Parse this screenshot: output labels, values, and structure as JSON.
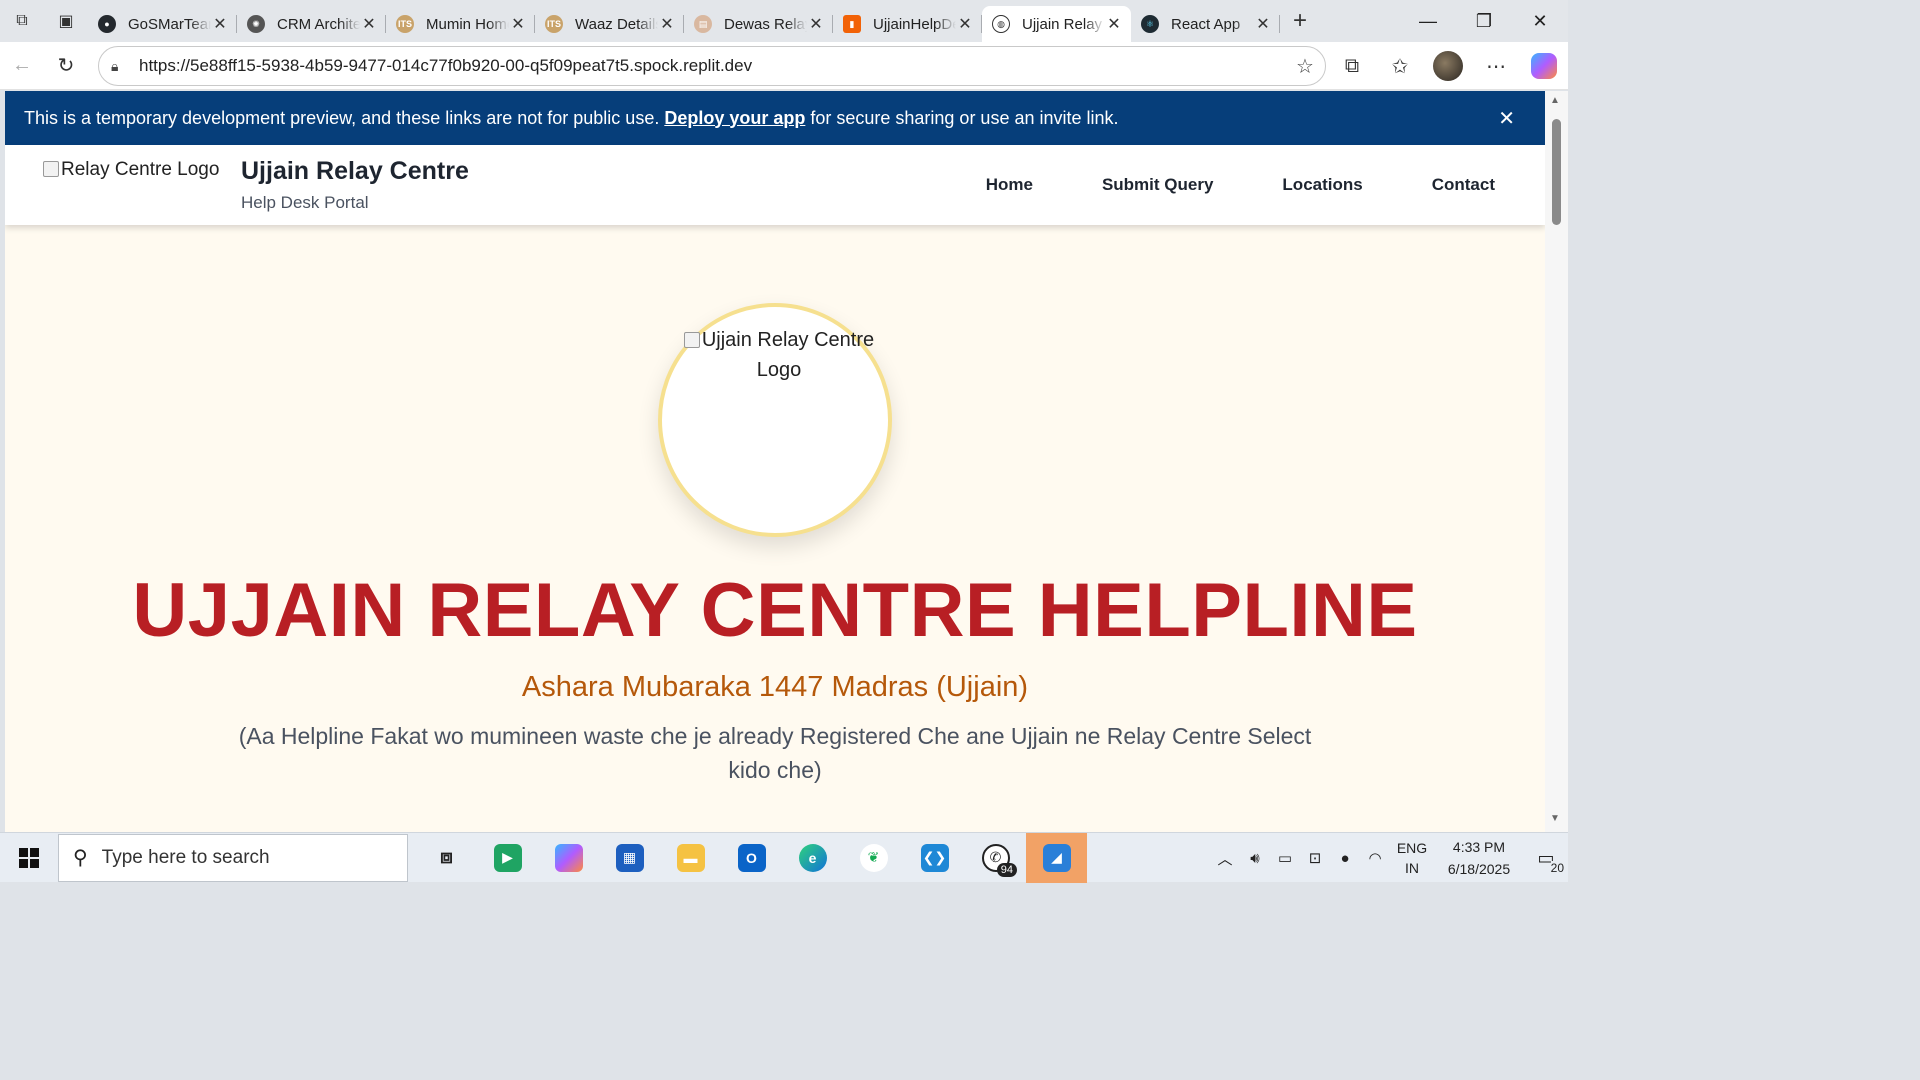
{
  "browser": {
    "tabs": [
      {
        "title": "GoSMarTeam",
        "icon": "github-icon",
        "color": "#24292e"
      },
      {
        "title": "CRM Architecture",
        "icon": "openai-icon",
        "color": "#555555"
      },
      {
        "title": "Mumin Home",
        "icon": "its-icon",
        "color": "#c9a36a"
      },
      {
        "title": "Waaz Details",
        "icon": "its-icon",
        "color": "#c9a36a"
      },
      {
        "title": "Dewas Relay",
        "icon": "page-icon",
        "color": "#d9b8a0"
      },
      {
        "title": "UjjainHelpDesk",
        "icon": "replit-icon",
        "color": "#f26207"
      },
      {
        "title": "Ujjain Relay Centre",
        "icon": "globe-icon",
        "color": "#444444",
        "active": true
      },
      {
        "title": "React App",
        "icon": "react-icon",
        "color": "#1e2b33"
      }
    ],
    "url": "https://5e88ff15-5938-4b59-9477-014c77f0b920-00-q5f09peat7t5.spock.replit.dev"
  },
  "banner": {
    "text_before": "This is a temporary development preview, and these links are not for public use.",
    "link": "Deploy your app",
    "text_after": "for secure sharing or use an invite link.",
    "close": "✕"
  },
  "header": {
    "logo_alt": "Relay Centre Logo",
    "title": "Ujjain Relay Centre",
    "subtitle": "Help Desk Portal",
    "nav": [
      "Home",
      "Submit Query",
      "Locations",
      "Contact"
    ]
  },
  "hero": {
    "logo_alt": "Ujjain Relay Centre Logo",
    "title": "UJJAIN RELAY CENTRE HELPLINE",
    "subtitle": "Ashara Mubaraka 1447 Madras (Ujjain)",
    "note": "(Aa Helpline Fakat wo mumineen waste che je already Registered Che ane Ujjain ne Relay Centre Select kido che)"
  },
  "taskbar": {
    "search_placeholder": "Type here to search",
    "whatsapp_badge": "94",
    "lang_line1": "ENG",
    "lang_line2": "IN",
    "time": "4:33 PM",
    "date": "6/18/2025",
    "notifications": "20"
  }
}
